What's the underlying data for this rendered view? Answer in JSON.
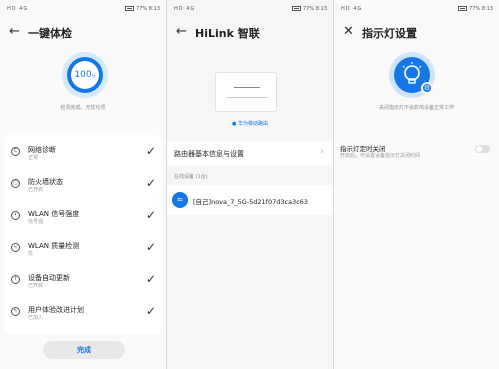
{
  "status_bar": {
    "carrier": "HD 4G",
    "battery": "77%",
    "time": "8:13"
  },
  "panel1": {
    "title": "一键体检",
    "score": "100",
    "score_unit": "分",
    "check_message": "检测完成，无优化项",
    "items": [
      {
        "icon": "diagnosis-icon",
        "title": "网络诊断",
        "subtitle": "正常"
      },
      {
        "icon": "firewall-icon",
        "title": "防火墙状态",
        "subtitle": "已开启"
      },
      {
        "icon": "wifi-signal-icon",
        "title": "WLAN 信号强度",
        "subtitle": "信号强"
      },
      {
        "icon": "wifi-quality-icon",
        "title": "WLAN 质量检测",
        "subtitle": "优"
      },
      {
        "icon": "update-icon",
        "title": "设备自动更新",
        "subtitle": "已开启"
      },
      {
        "icon": "user-plan-icon",
        "title": "用户体验改进计划",
        "subtitle": "已加入"
      }
    ],
    "done_label": "完成"
  },
  "panel2": {
    "title": "HiLink 智联",
    "router_caption": "华为移动路由",
    "info_label": "路由器基本信息与设置",
    "online_label": "在线设备 (1台)",
    "device_name": "[自己]nova_7_5G-5d21f07d3ca3c63"
  },
  "panel3": {
    "title": "指示灯设置",
    "message": "关闭指示灯不会影响设备正常工作",
    "setting_title": "指示灯定时关闭",
    "setting_subtitle": "开启后，可设置设备指示灯关闭时间",
    "toggle_on": false
  },
  "colors": {
    "accent": "#1576e6"
  }
}
